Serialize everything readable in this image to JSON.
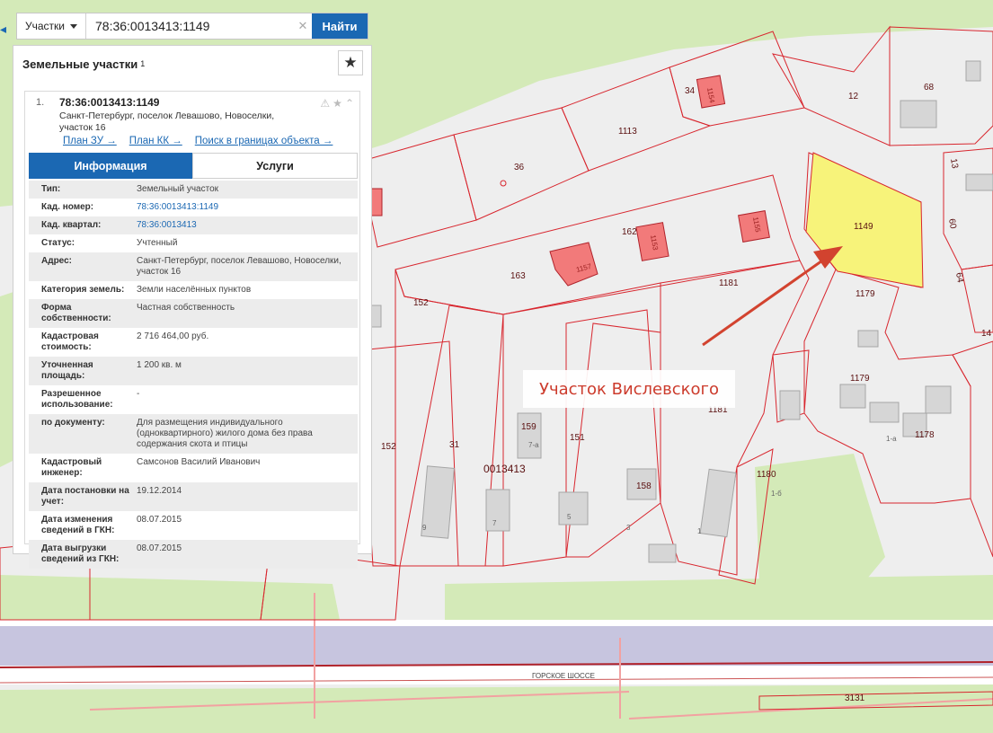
{
  "search": {
    "dropdown_label": "Участки",
    "query": "78:36:0013413:1149",
    "button_label": "Найти"
  },
  "panel": {
    "title": "Земельные участки",
    "count": "1",
    "result": {
      "index": "1.",
      "cadastral_number": "78:36:0013413:1149",
      "address": "Санкт-Петербург, поселок Левашово, Новоселки, участок 16",
      "links": [
        "План ЗУ →",
        "План КК →",
        "Поиск в границах объекта →"
      ],
      "tabs": [
        {
          "label": "Информация",
          "active": true
        },
        {
          "label": "Услуги",
          "active": false
        }
      ],
      "info_rows": [
        {
          "key": "Тип:",
          "value": "Земельный участок"
        },
        {
          "key": "Кад. номер:",
          "value": "78:36:0013413:1149",
          "link": true
        },
        {
          "key": "Кад. квартал:",
          "value": "78:36:0013413",
          "link": true
        },
        {
          "key": "Статус:",
          "value": "Учтенный"
        },
        {
          "key": "Адрес:",
          "value": "Санкт-Петербург, поселок Левашово, Новоселки, участок 16"
        },
        {
          "key": "Категория земель:",
          "value": "Земли населённых пунктов"
        },
        {
          "key": "Форма собственности:",
          "value": "Частная собственность"
        },
        {
          "key": "Кадастровая стоимость:",
          "value": "2 716 464,00 руб."
        },
        {
          "key": "Уточненная площадь:",
          "value": "1 200 кв. м"
        },
        {
          "key": "Разрешенное использование:",
          "value": "-"
        },
        {
          "key": "по документу:",
          "value": "Для размещения индивидуального (одноквартирного) жилого дома без права содержания скота и птицы"
        },
        {
          "key": "Кадастровый инженер:",
          "value": "Самсонов Василий Иванович"
        },
        {
          "key": "Дата постановки на учет:",
          "value": "19.12.2014"
        },
        {
          "key": "Дата изменения сведений в ГКН:",
          "value": "08.07.2015"
        },
        {
          "key": "Дата выгрузки сведений из ГКН:",
          "value": "08.07.2015"
        }
      ]
    }
  },
  "map": {
    "annotation": "Участок Вислевского",
    "highlight_color": "#f7f37a",
    "building_color": "#f27a7a",
    "boundary_color": "#d8262e",
    "road_name": "ГОРСКОЕ ШОССЕ",
    "block_label": "0013413",
    "parcel_labels": [
      "1149",
      "1179",
      "1179",
      "1178",
      "1181",
      "1181",
      "1180",
      "68",
      "12",
      "34",
      "1113",
      "36",
      "162",
      "163",
      "152",
      "152",
      "31",
      "159",
      "151",
      "158",
      "3131",
      "13",
      "60",
      "64",
      "14"
    ],
    "building_labels": [
      "1157",
      "1153",
      "1155",
      "1154"
    ],
    "house_labels": [
      "9",
      "7",
      "5",
      "3",
      "1",
      "7-а",
      "1-б",
      "1-а"
    ]
  }
}
